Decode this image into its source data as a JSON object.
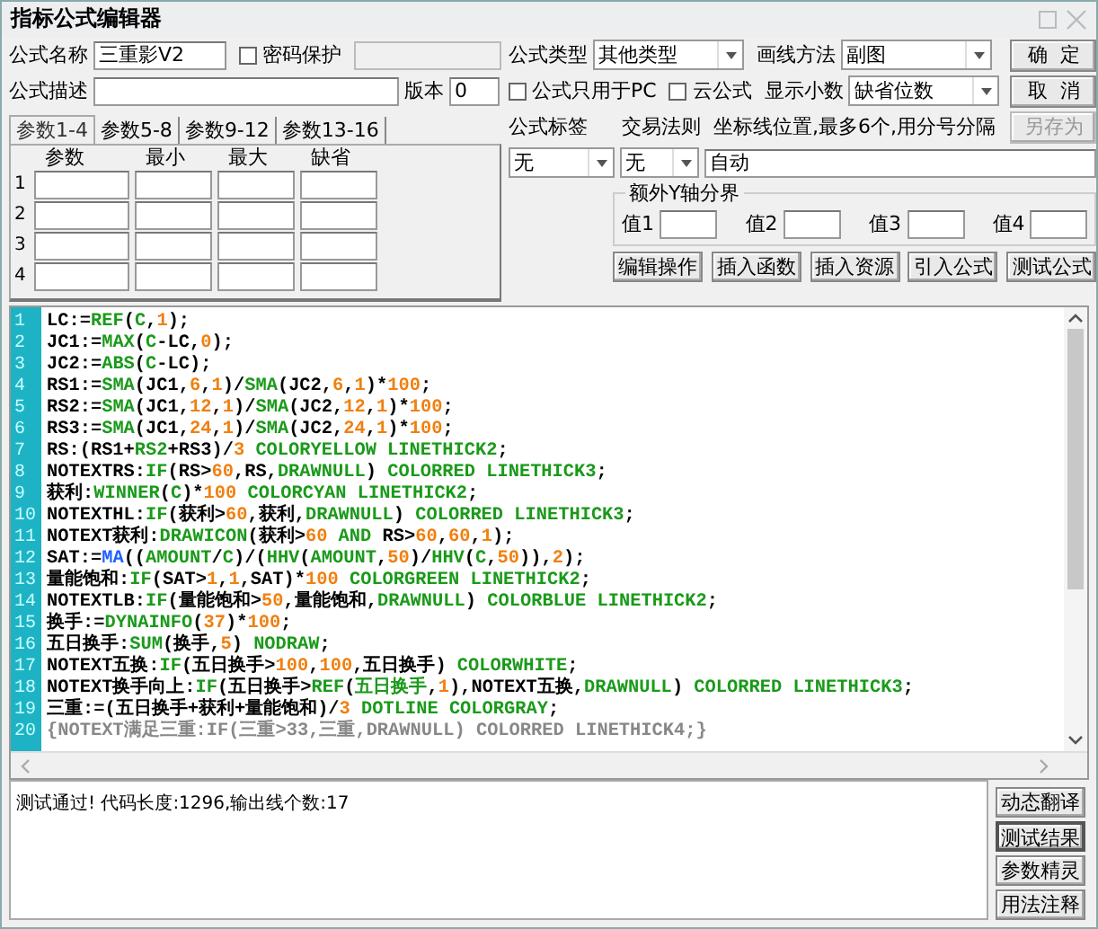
{
  "window": {
    "title": "指标公式编辑器"
  },
  "form": {
    "name_label": "公式名称",
    "name_value": "三重影V2",
    "password": {
      "label": "密码保护",
      "checked": false
    },
    "desc_label": "公式描述",
    "version_label": "版本",
    "version_value": "0",
    "type_label": "公式类型",
    "type_value": "其他类型",
    "draw_label": "画线方法",
    "draw_value": "副图",
    "pc_only": {
      "label": "公式只用于PC",
      "checked": false
    },
    "cloud": {
      "label": "云公式",
      "checked": false
    },
    "decimals_label": "显示小数",
    "decimals_value": "缺省位数"
  },
  "action_buttons": [
    {
      "label": "确  定",
      "disabled": false
    },
    {
      "label": "取  消",
      "disabled": false
    },
    {
      "label": "另存为",
      "disabled": true
    }
  ],
  "param_tabs": [
    {
      "label": "参数1-4",
      "selected": true
    },
    {
      "label": "参数5-8",
      "selected": false
    },
    {
      "label": "参数9-12",
      "selected": false
    },
    {
      "label": "参数13-16",
      "selected": false
    }
  ],
  "param_columns": [
    "参数",
    "最小",
    "最大",
    "缺省"
  ],
  "param_rows": [
    "1",
    "2",
    "3",
    "4"
  ],
  "tag": {
    "label": "公式标签",
    "value": "无"
  },
  "rule": {
    "label": "交易法则",
    "value": "无"
  },
  "axis": {
    "label": "坐标线位置,最多6个,用分号分隔",
    "value": "自动"
  },
  "y_bounds": {
    "title": "额外Y轴分界",
    "fields": [
      "值1",
      "值2",
      "值3",
      "值4"
    ]
  },
  "tool_buttons": [
    "编辑操作",
    "插入函数",
    "插入资源",
    "引入公式",
    "测试公式"
  ],
  "code_lines": [
    {
      "number": "1",
      "tokens": [
        {
          "kind": "text",
          "text": "LC:="
        },
        {
          "kind": "func",
          "text": "REF"
        },
        {
          "kind": "text",
          "text": "("
        },
        {
          "kind": "func",
          "text": "C"
        },
        {
          "kind": "text",
          "text": ","
        },
        {
          "kind": "num",
          "text": "1"
        },
        {
          "kind": "text",
          "text": ");"
        }
      ]
    },
    {
      "number": "2",
      "tokens": [
        {
          "kind": "text",
          "text": "JC1:="
        },
        {
          "kind": "func",
          "text": "MAX"
        },
        {
          "kind": "text",
          "text": "("
        },
        {
          "kind": "func",
          "text": "C"
        },
        {
          "kind": "text",
          "text": "-LC,"
        },
        {
          "kind": "num",
          "text": "0"
        },
        {
          "kind": "text",
          "text": ");"
        }
      ]
    },
    {
      "number": "3",
      "tokens": [
        {
          "kind": "text",
          "text": "JC2:="
        },
        {
          "kind": "func",
          "text": "ABS"
        },
        {
          "kind": "text",
          "text": "("
        },
        {
          "kind": "func",
          "text": "C"
        },
        {
          "kind": "text",
          "text": "-LC);"
        }
      ]
    },
    {
      "number": "4",
      "tokens": [
        {
          "kind": "text",
          "text": "RS1:="
        },
        {
          "kind": "func",
          "text": "SMA"
        },
        {
          "kind": "text",
          "text": "(JC1,"
        },
        {
          "kind": "num",
          "text": "6"
        },
        {
          "kind": "text",
          "text": ","
        },
        {
          "kind": "num",
          "text": "1"
        },
        {
          "kind": "text",
          "text": ")/"
        },
        {
          "kind": "func",
          "text": "SMA"
        },
        {
          "kind": "text",
          "text": "(JC2,"
        },
        {
          "kind": "num",
          "text": "6"
        },
        {
          "kind": "text",
          "text": ","
        },
        {
          "kind": "num",
          "text": "1"
        },
        {
          "kind": "text",
          "text": ")*"
        },
        {
          "kind": "num",
          "text": "100"
        },
        {
          "kind": "text",
          "text": ";"
        }
      ]
    },
    {
      "number": "5",
      "tokens": [
        {
          "kind": "text",
          "text": "RS2:="
        },
        {
          "kind": "func",
          "text": "SMA"
        },
        {
          "kind": "text",
          "text": "(JC1,"
        },
        {
          "kind": "num",
          "text": "12"
        },
        {
          "kind": "text",
          "text": ","
        },
        {
          "kind": "num",
          "text": "1"
        },
        {
          "kind": "text",
          "text": ")/"
        },
        {
          "kind": "func",
          "text": "SMA"
        },
        {
          "kind": "text",
          "text": "(JC2,"
        },
        {
          "kind": "num",
          "text": "12"
        },
        {
          "kind": "text",
          "text": ","
        },
        {
          "kind": "num",
          "text": "1"
        },
        {
          "kind": "text",
          "text": ")*"
        },
        {
          "kind": "num",
          "text": "100"
        },
        {
          "kind": "text",
          "text": ";"
        }
      ]
    },
    {
      "number": "6",
      "tokens": [
        {
          "kind": "text",
          "text": "RS3:="
        },
        {
          "kind": "func",
          "text": "SMA"
        },
        {
          "kind": "text",
          "text": "(JC1,"
        },
        {
          "kind": "num",
          "text": "24"
        },
        {
          "kind": "text",
          "text": ","
        },
        {
          "kind": "num",
          "text": "1"
        },
        {
          "kind": "text",
          "text": ")/"
        },
        {
          "kind": "func",
          "text": "SMA"
        },
        {
          "kind": "text",
          "text": "(JC2,"
        },
        {
          "kind": "num",
          "text": "24"
        },
        {
          "kind": "text",
          "text": ","
        },
        {
          "kind": "num",
          "text": "1"
        },
        {
          "kind": "text",
          "text": ")*"
        },
        {
          "kind": "num",
          "text": "100"
        },
        {
          "kind": "text",
          "text": ";"
        }
      ]
    },
    {
      "number": "7",
      "tokens": [
        {
          "kind": "text",
          "text": "RS:(RS1+"
        },
        {
          "kind": "func",
          "text": "RS2"
        },
        {
          "kind": "text",
          "text": "+RS3)/"
        },
        {
          "kind": "num",
          "text": "3 "
        },
        {
          "kind": "func",
          "text": "COLORYELLOW LINETHICK2"
        },
        {
          "kind": "text",
          "text": ";"
        }
      ]
    },
    {
      "number": "8",
      "tokens": [
        {
          "kind": "text",
          "text": "NOTEXTRS:"
        },
        {
          "kind": "func",
          "text": "IF"
        },
        {
          "kind": "text",
          "text": "(RS>"
        },
        {
          "kind": "num",
          "text": "60"
        },
        {
          "kind": "text",
          "text": ",RS,"
        },
        {
          "kind": "func",
          "text": "DRAWNULL"
        },
        {
          "kind": "text",
          "text": ") "
        },
        {
          "kind": "func",
          "text": "COLORRED LINETHICK3"
        },
        {
          "kind": "text",
          "text": ";"
        }
      ]
    },
    {
      "number": "9",
      "tokens": [
        {
          "kind": "text",
          "text": "获利:"
        },
        {
          "kind": "func",
          "text": "WINNER"
        },
        {
          "kind": "text",
          "text": "("
        },
        {
          "kind": "func",
          "text": "C"
        },
        {
          "kind": "text",
          "text": ")*"
        },
        {
          "kind": "num",
          "text": "100 "
        },
        {
          "kind": "func",
          "text": "COLORCYAN LINETHICK2"
        },
        {
          "kind": "text",
          "text": ";"
        }
      ]
    },
    {
      "number": "10",
      "tokens": [
        {
          "kind": "text",
          "text": "NOTEXTHL:"
        },
        {
          "kind": "func",
          "text": "IF"
        },
        {
          "kind": "text",
          "text": "(获利>"
        },
        {
          "kind": "num",
          "text": "60"
        },
        {
          "kind": "text",
          "text": ",获利,"
        },
        {
          "kind": "func",
          "text": "DRAWNULL"
        },
        {
          "kind": "text",
          "text": ") "
        },
        {
          "kind": "func",
          "text": "COLORRED LINETHICK3"
        },
        {
          "kind": "text",
          "text": ";"
        }
      ]
    },
    {
      "number": "11",
      "tokens": [
        {
          "kind": "text",
          "text": "NOTEXT获利:"
        },
        {
          "kind": "func",
          "text": "DRAWICON"
        },
        {
          "kind": "text",
          "text": "(获利>"
        },
        {
          "kind": "num",
          "text": "60 "
        },
        {
          "kind": "func",
          "text": "AND"
        },
        {
          "kind": "text",
          "text": " RS>"
        },
        {
          "kind": "num",
          "text": "60"
        },
        {
          "kind": "text",
          "text": ","
        },
        {
          "kind": "num",
          "text": "60"
        },
        {
          "kind": "text",
          "text": ","
        },
        {
          "kind": "num",
          "text": "1"
        },
        {
          "kind": "text",
          "text": ");"
        }
      ]
    },
    {
      "number": "12",
      "tokens": [
        {
          "kind": "text",
          "text": "SAT:="
        },
        {
          "kind": "blue",
          "text": "MA"
        },
        {
          "kind": "text",
          "text": "(("
        },
        {
          "kind": "func",
          "text": "AMOUNT"
        },
        {
          "kind": "text",
          "text": "/"
        },
        {
          "kind": "func",
          "text": "C"
        },
        {
          "kind": "text",
          "text": ")/("
        },
        {
          "kind": "func",
          "text": "HHV"
        },
        {
          "kind": "text",
          "text": "("
        },
        {
          "kind": "func",
          "text": "AMOUNT"
        },
        {
          "kind": "text",
          "text": ","
        },
        {
          "kind": "num",
          "text": "50"
        },
        {
          "kind": "text",
          "text": ")/"
        },
        {
          "kind": "func",
          "text": "HHV"
        },
        {
          "kind": "text",
          "text": "("
        },
        {
          "kind": "func",
          "text": "C"
        },
        {
          "kind": "text",
          "text": ","
        },
        {
          "kind": "num",
          "text": "50"
        },
        {
          "kind": "text",
          "text": ")),"
        },
        {
          "kind": "num",
          "text": "2"
        },
        {
          "kind": "text",
          "text": ");"
        }
      ]
    },
    {
      "number": "13",
      "tokens": [
        {
          "kind": "text",
          "text": "量能饱和:"
        },
        {
          "kind": "func",
          "text": "IF"
        },
        {
          "kind": "text",
          "text": "(SAT>"
        },
        {
          "kind": "num",
          "text": "1"
        },
        {
          "kind": "text",
          "text": ","
        },
        {
          "kind": "num",
          "text": "1"
        },
        {
          "kind": "text",
          "text": ",SAT)*"
        },
        {
          "kind": "num",
          "text": "100 "
        },
        {
          "kind": "func",
          "text": "COLORGREEN LINETHICK2"
        },
        {
          "kind": "text",
          "text": ";"
        }
      ]
    },
    {
      "number": "14",
      "tokens": [
        {
          "kind": "text",
          "text": "NOTEXTLB:"
        },
        {
          "kind": "func",
          "text": "IF"
        },
        {
          "kind": "text",
          "text": "(量能饱和>"
        },
        {
          "kind": "num",
          "text": "50"
        },
        {
          "kind": "text",
          "text": ",量能饱和,"
        },
        {
          "kind": "func",
          "text": "DRAWNULL"
        },
        {
          "kind": "text",
          "text": ") "
        },
        {
          "kind": "func",
          "text": "COLORBLUE LINETHICK2"
        },
        {
          "kind": "text",
          "text": ";"
        }
      ]
    },
    {
      "number": "15",
      "tokens": [
        {
          "kind": "text",
          "text": "换手:="
        },
        {
          "kind": "func",
          "text": "DYNAINFO"
        },
        {
          "kind": "text",
          "text": "("
        },
        {
          "kind": "num",
          "text": "37"
        },
        {
          "kind": "text",
          "text": ")*"
        },
        {
          "kind": "num",
          "text": "100"
        },
        {
          "kind": "text",
          "text": ";"
        }
      ]
    },
    {
      "number": "16",
      "tokens": [
        {
          "kind": "text",
          "text": "五日换手:"
        },
        {
          "kind": "func",
          "text": "SUM"
        },
        {
          "kind": "text",
          "text": "(换手,"
        },
        {
          "kind": "num",
          "text": "5"
        },
        {
          "kind": "text",
          "text": ") "
        },
        {
          "kind": "func",
          "text": "NODRAW"
        },
        {
          "kind": "text",
          "text": ";"
        }
      ]
    },
    {
      "number": "17",
      "tokens": [
        {
          "kind": "text",
          "text": "NOTEXT五换:"
        },
        {
          "kind": "func",
          "text": "IF"
        },
        {
          "kind": "text",
          "text": "(五日换手>"
        },
        {
          "kind": "num",
          "text": "100"
        },
        {
          "kind": "text",
          "text": ","
        },
        {
          "kind": "num",
          "text": "100"
        },
        {
          "kind": "text",
          "text": ",五日换手) "
        },
        {
          "kind": "func",
          "text": "COLORWHITE"
        },
        {
          "kind": "text",
          "text": ";"
        }
      ]
    },
    {
      "number": "18",
      "tokens": [
        {
          "kind": "text",
          "text": "NOTEXT换手向上:"
        },
        {
          "kind": "func",
          "text": "IF"
        },
        {
          "kind": "text",
          "text": "(五日换手>"
        },
        {
          "kind": "func",
          "text": "REF"
        },
        {
          "kind": "text",
          "text": "("
        },
        {
          "kind": "func",
          "text": "五日换手"
        },
        {
          "kind": "text",
          "text": ","
        },
        {
          "kind": "num",
          "text": "1"
        },
        {
          "kind": "text",
          "text": "),NOTEXT五换,"
        },
        {
          "kind": "func",
          "text": "DRAWNULL"
        },
        {
          "kind": "text",
          "text": ") "
        },
        {
          "kind": "func",
          "text": "COLORRED LINETHICK3"
        },
        {
          "kind": "text",
          "text": ";"
        }
      ]
    },
    {
      "number": "19",
      "tokens": [
        {
          "kind": "text",
          "text": "三重:=(五日换手+获利+量能饱和)/"
        },
        {
          "kind": "num",
          "text": "3 "
        },
        {
          "kind": "func",
          "text": "DOTLINE COLORGRAY"
        },
        {
          "kind": "text",
          "text": ";"
        }
      ]
    },
    {
      "number": "20",
      "tokens": [
        {
          "kind": "comment",
          "text": "{NOTEXT满足三重:IF(三重>33,三重,DRAWNULL) COLORRED LINETHICK4;}"
        }
      ]
    }
  ],
  "status": "测试通过! 代码长度:1296,输出线个数:17",
  "side_buttons": [
    {
      "label": "动态翻译",
      "selected": false
    },
    {
      "label": "测试结果",
      "selected": true
    },
    {
      "label": "参数精灵",
      "selected": false
    },
    {
      "label": "用法注释",
      "selected": false
    }
  ]
}
